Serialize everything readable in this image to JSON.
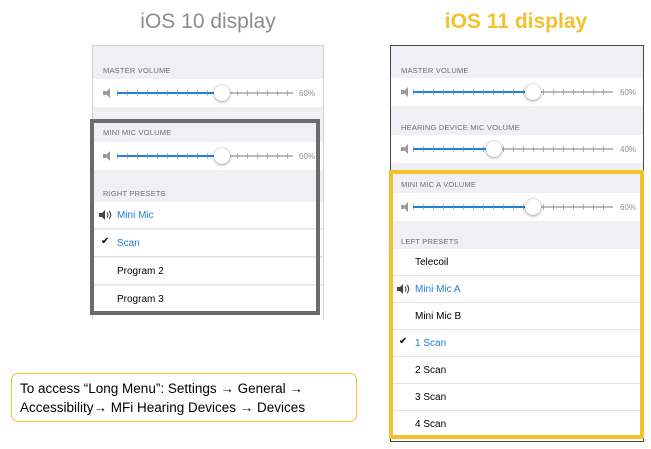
{
  "titles": {
    "left": "iOS 10 display",
    "right": "iOS 11 display"
  },
  "colors": {
    "accent_blue": "#1a7fe0",
    "highlight_gray": "#6b6b6b",
    "highlight_yellow": "#f2c12e"
  },
  "ios10": {
    "master_header": "MASTER VOLUME",
    "master_value": "60%",
    "mic_header": "MINI MIC VOLUME",
    "mic_value": "60%",
    "presets_header": "RIGHT PRESETS",
    "presets": [
      {
        "label": "Mini Mic",
        "state": "playing",
        "icon": "speaker-icon"
      },
      {
        "label": "Scan",
        "state": "selected",
        "icon": "checkmark-icon"
      },
      {
        "label": "Program 2",
        "state": "none"
      },
      {
        "label": "Program 3",
        "state": "none"
      }
    ]
  },
  "ios11": {
    "master_header": "MASTER VOLUME",
    "master_value": "60%",
    "hearing_header": "HEARING DEVICE MIC VOLUME",
    "hearing_value": "40%",
    "mic_header": "MINI MIC A VOLUME",
    "mic_value": "60%",
    "presets_header": "LEFT PRESETS",
    "presets": [
      {
        "label": "Telecoil",
        "state": "none"
      },
      {
        "label": "Mini Mic A",
        "state": "playing",
        "icon": "speaker-icon"
      },
      {
        "label": "Mini Mic B",
        "state": "none"
      },
      {
        "label": "1 Scan",
        "state": "selected",
        "icon": "checkmark-icon"
      },
      {
        "label": "2 Scan",
        "state": "none"
      },
      {
        "label": "3 Scan",
        "state": "none"
      },
      {
        "label": "4 Scan",
        "state": "none"
      }
    ]
  },
  "note": {
    "line1": "To access “Long Menu”: Settings → General →",
    "line2": "Accessibility→ MFi Hearing Devices → Devices"
  }
}
